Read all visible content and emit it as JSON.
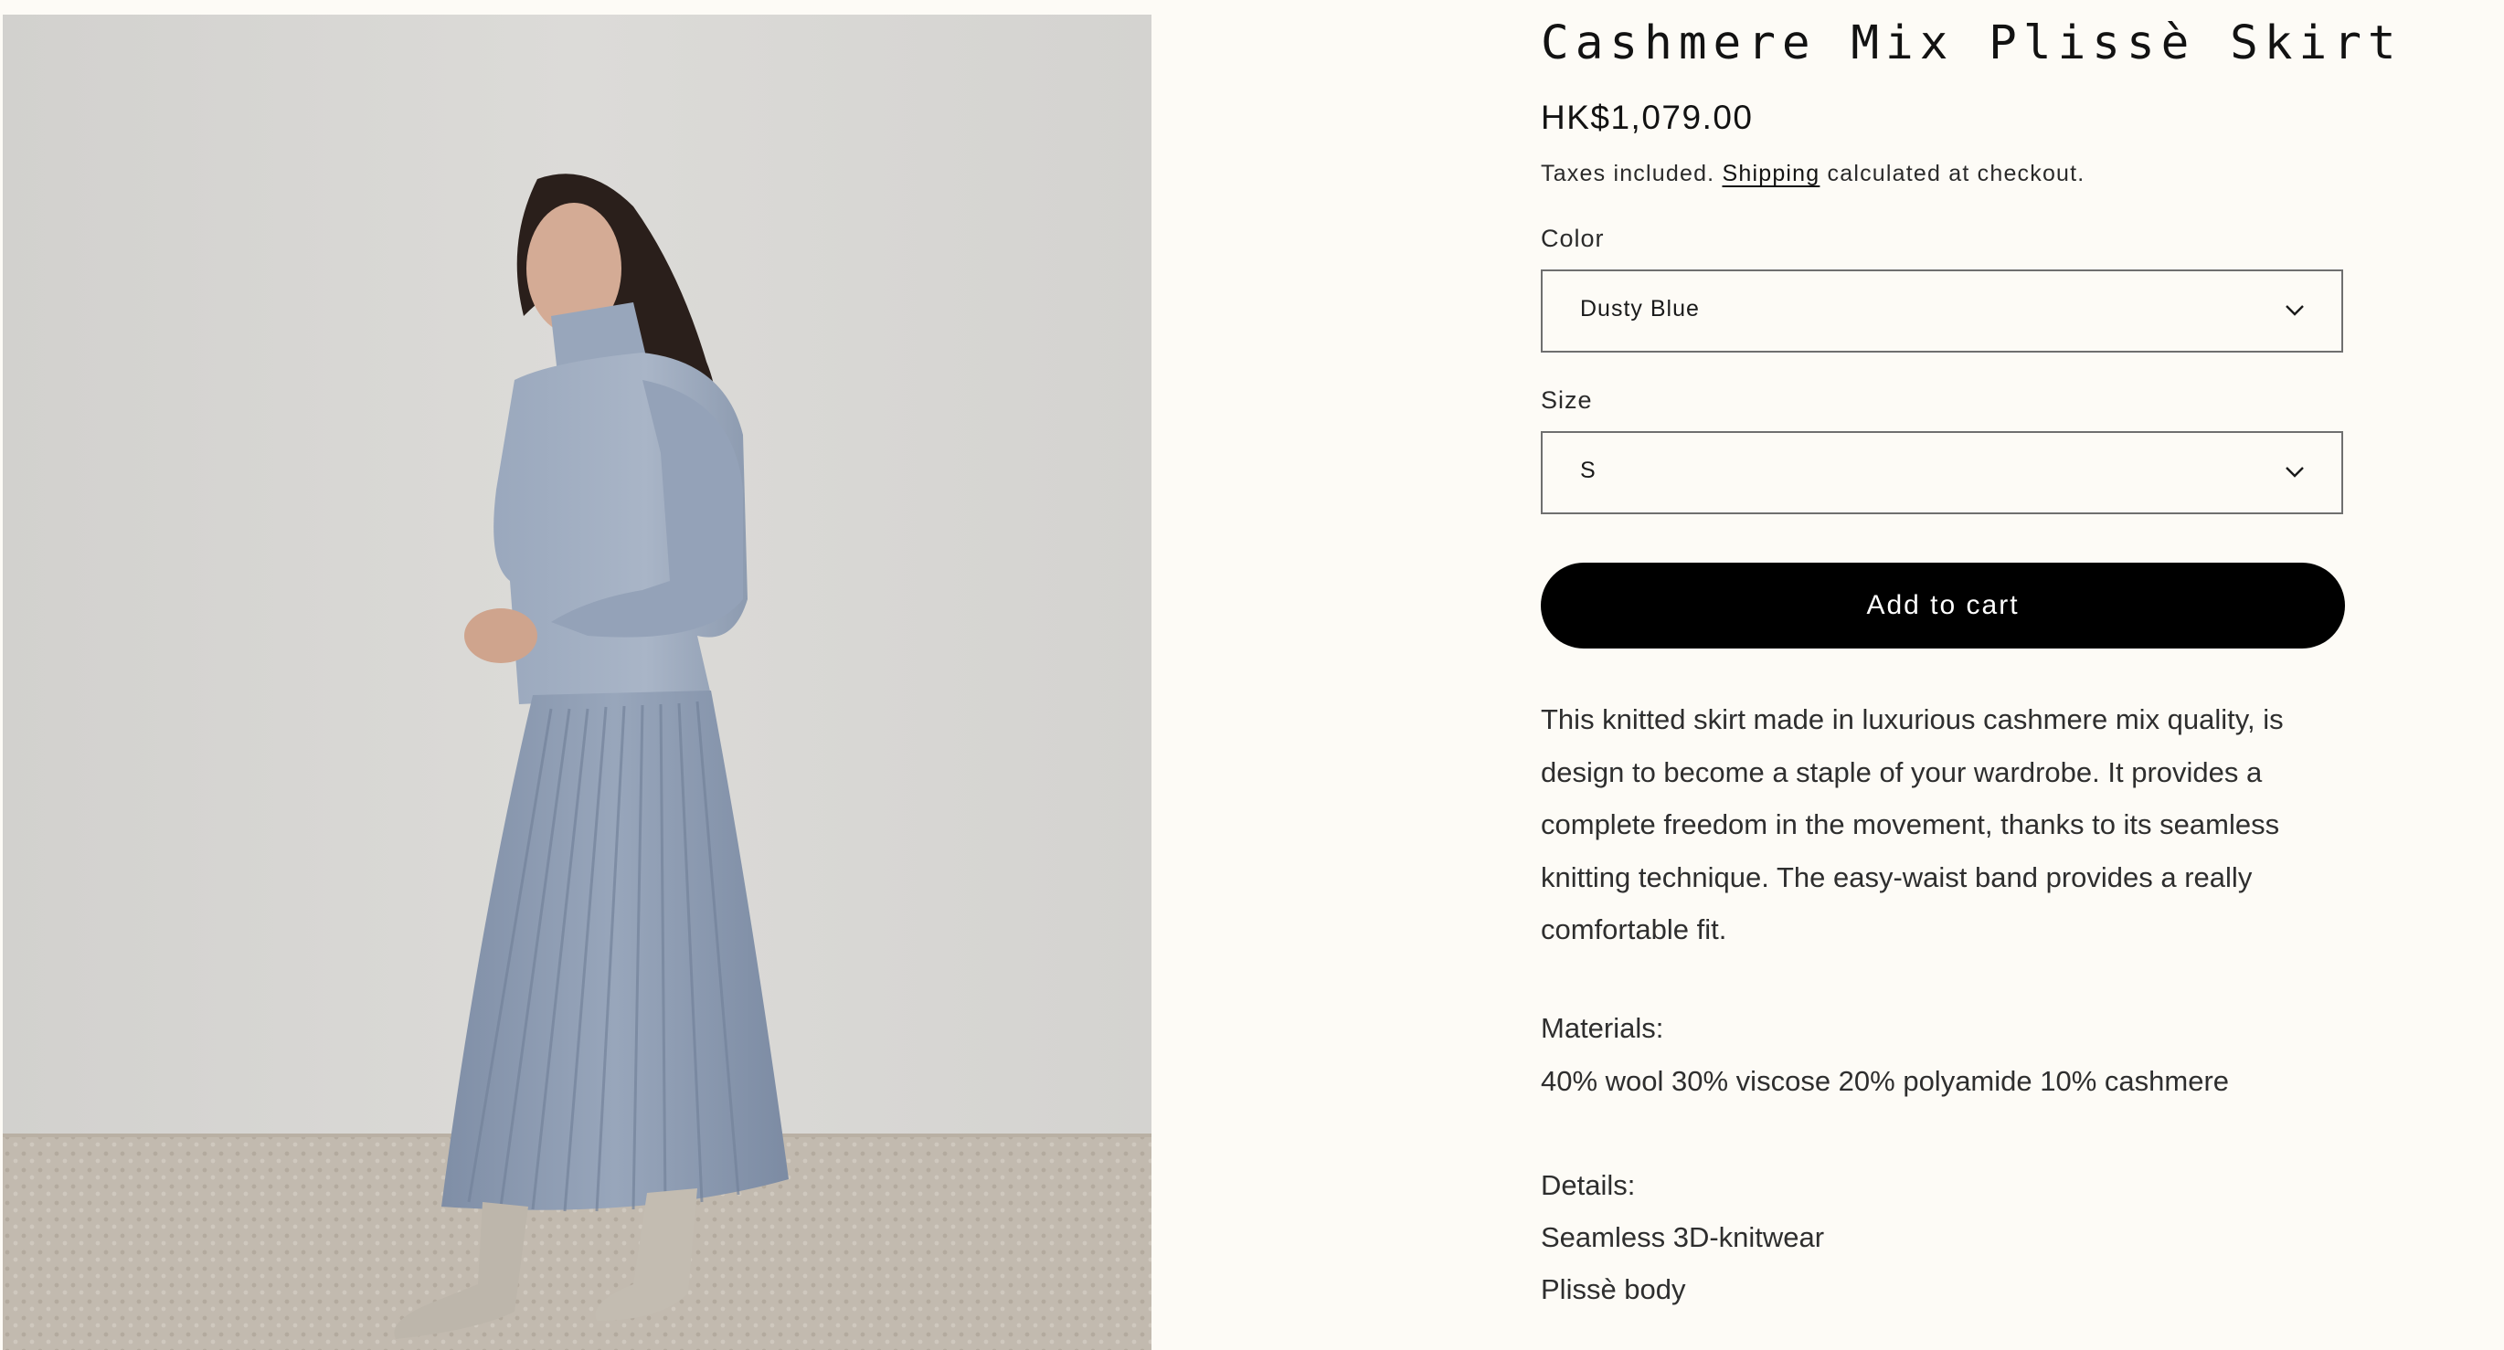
{
  "product": {
    "title": "Cashmere Mix Plissè Skirt",
    "price": "HK$1,079.00",
    "tax_note": {
      "prefix": "Taxes included. ",
      "link": "Shipping",
      "suffix": " calculated at checkout."
    }
  },
  "options": {
    "color": {
      "label": "Color",
      "selected": "Dusty Blue"
    },
    "size": {
      "label": "Size",
      "selected": "S"
    }
  },
  "add_to_cart": "Add to cart",
  "description": "This knitted skirt made in luxurious cashmere mix quality, is design to become a staple of your wardrobe. It provides a complete freedom in the movement, thanks to its seamless knitting technique. The easy-waist band provides a really comfortable fit.",
  "materials": {
    "heading": "Materials:",
    "text": "40% wool 30% viscose 20% polyamide 10% cashmere"
  },
  "details": {
    "heading": "Details:",
    "items": [
      "Seamless 3D-knitwear",
      "Plissè body"
    ]
  },
  "colors": {
    "page_background": "#fdfbf6",
    "button": "#000000",
    "button_text": "#ffffff",
    "garment": "#8e9db3"
  },
  "icons": {
    "dropdown": "chevron-down-icon"
  }
}
